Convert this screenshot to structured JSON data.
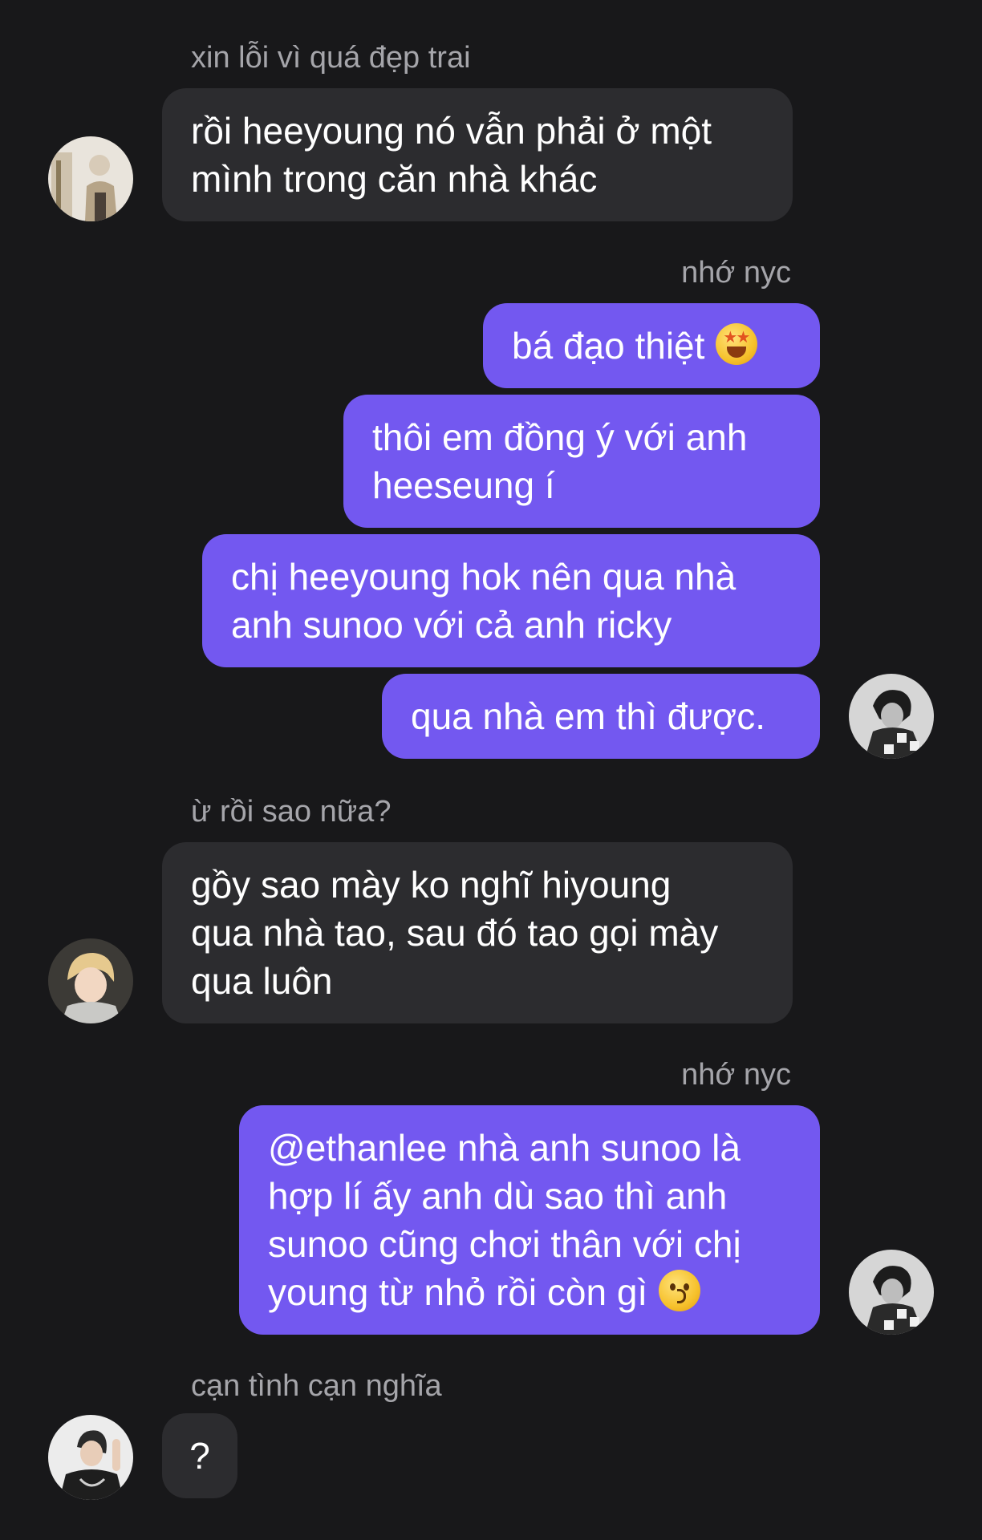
{
  "messages": [
    {
      "type": "name",
      "side": "in",
      "text": "xin lỗi vì quá đẹp trai"
    },
    {
      "type": "bubble",
      "side": "in",
      "line1": "rồi heeyoung nó vẫn phải ở một",
      "line2": "mình trong căn nhà khác"
    },
    {
      "type": "name",
      "side": "out",
      "text": "nhớ nyc"
    },
    {
      "type": "bubble",
      "side": "out",
      "text": "bá đạo thiệt",
      "emoji": "star-struck-icon"
    },
    {
      "type": "bubble",
      "side": "out",
      "line1": "thôi em đồng ý với anh",
      "line2": "heeseung í"
    },
    {
      "type": "bubble",
      "side": "out",
      "line1": "chị heeyoung hok nên qua nhà",
      "line2": "anh sunoo với cả anh ricky"
    },
    {
      "type": "bubble",
      "side": "out",
      "text": "qua nhà em thì được."
    },
    {
      "type": "name",
      "side": "in",
      "text": "ừ rồi sao nữa?"
    },
    {
      "type": "bubble",
      "side": "in",
      "line1": "gồy sao mày ko nghĩ hiyoung",
      "line2": "qua nhà tao, sau đó tao gọi mày",
      "line3": "qua luôn"
    },
    {
      "type": "name",
      "side": "out",
      "text": "nhớ nyc"
    },
    {
      "type": "bubble",
      "side": "out",
      "line1": "@ethanlee nhà anh sunoo là",
      "line2": "hợp lí ấy anh dù sao thì anh",
      "line3": "sunoo cũng chơi thân với chị",
      "line4": "young từ nhỏ rồi còn gì",
      "emoji": "kissing-face-icon"
    },
    {
      "type": "name",
      "side": "in",
      "text": "cạn tình cạn nghĩa"
    },
    {
      "type": "bubble",
      "side": "in",
      "text": "?"
    }
  ],
  "colors": {
    "background": "#18181a",
    "incoming_bubble": "#2c2c2f",
    "outgoing_bubble": "#7358f0",
    "name_text": "#a5a5aa"
  }
}
